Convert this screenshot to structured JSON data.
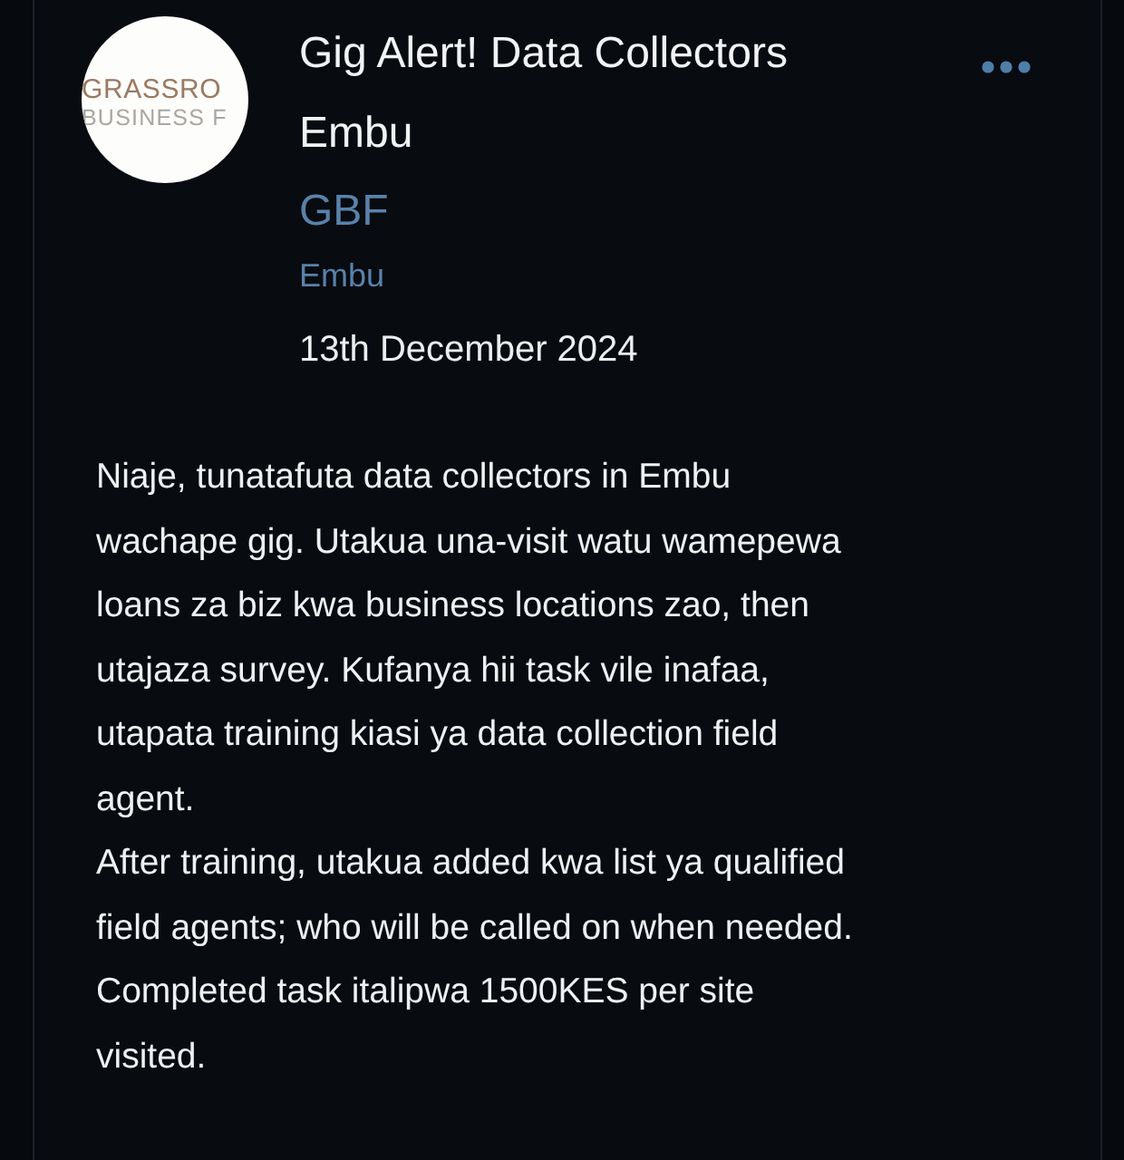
{
  "post": {
    "logo": {
      "line_1": "GRASSRO",
      "line_2": "BUSINESS F"
    },
    "title": "Gig Alert! Data Collectors\nEmbu",
    "organization": "GBF",
    "location": "Embu",
    "date": "13th December 2024",
    "body": [
      "Niaje, tunatafuta data collectors in Embu\nwachape gig. Utakua una-visit watu wamepewa\nloans za biz kwa business locations zao, then\nutajaza survey. Kufanya hii task vile inafaa,\nutapata training kiasi ya data collection field\nagent.",
      "After training, utakua added kwa list ya qualified\nfield agents; who will be called on when needed.\nCompleted task italipwa 1500KES per site\nvisited."
    ]
  }
}
